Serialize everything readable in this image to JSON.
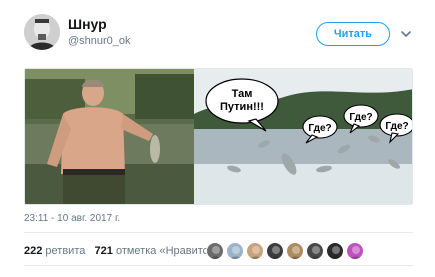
{
  "author": {
    "name": "Шнур",
    "handle": "@shnur0_ok"
  },
  "follow_label": "Читать",
  "media": {
    "bubble_left": [
      "Там",
      "Путин!!!"
    ],
    "bubble_right": [
      "Где?",
      "Где?",
      "Где?"
    ]
  },
  "timestamp": "23:11 - 10 авг. 2017 г.",
  "stats": {
    "retweets_count": "222",
    "retweets_label": "ретвита",
    "likes_count": "721",
    "likes_label": "отметка «Нравится»"
  },
  "likers": [
    {
      "color": "#6b6b6b"
    },
    {
      "color": "#9bb3c8"
    },
    {
      "color": "#c7a27a"
    },
    {
      "color": "#3d3d3d"
    },
    {
      "color": "#b08a5f"
    },
    {
      "color": "#4a4a4a"
    },
    {
      "color": "#2a2a2a"
    },
    {
      "color": "#c050c0"
    }
  ],
  "colors": {
    "accent": "#1da1f2",
    "muted": "#657786"
  }
}
